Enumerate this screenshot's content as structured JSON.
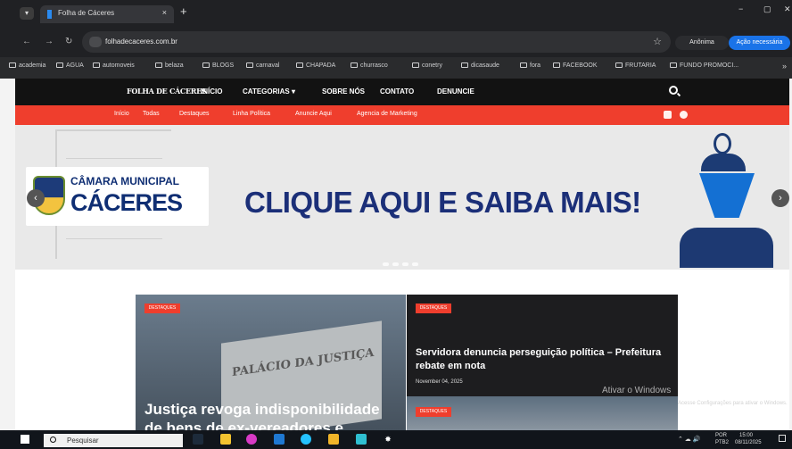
{
  "browser": {
    "tab_title": "Folha de Cáceres",
    "tab_close": "×",
    "new_tab": "+",
    "window_controls": [
      "−",
      "▢",
      "✕"
    ],
    "url": "folhadecaceres.com.br",
    "anonymous_label": "Anônima",
    "update_label": "Ação necessária",
    "nav_icons": [
      "←",
      "→",
      "↻"
    ],
    "bookmarks": [
      "academia",
      "AGUA",
      "automoveis",
      "belaza",
      "BLOGS",
      "carnaval",
      "CHAPADA",
      "churrasco",
      "conetry",
      "dicasaude",
      "fora",
      "FACEBOOK",
      "FRUTARIA",
      "FUNDO PROMOCI..."
    ]
  },
  "site": {
    "logo": "FOLHA DE CÁCERES",
    "nav": [
      "INÍCIO",
      "CATEGORIAS ▾",
      "SOBRE NÓS",
      "CONTATO",
      "DENUNCIE"
    ],
    "subnav": [
      "Início",
      "Todas",
      "Destaques",
      "Linha Política",
      "Anuncie Aqui",
      "Agencia de Marketing"
    ]
  },
  "banner": {
    "title_small": "CÂMARA MUNICIPAL",
    "title_big": "CÁCERES",
    "headline": "CLIQUE AQUI E SAIBA MAIS!",
    "left_arrow": "‹",
    "right_arrow": "›"
  },
  "posts": {
    "main_tag": "DESTAQUES",
    "main_title": "Justiça revoga indisponibilidade de bens de ex-vereadores e",
    "main_court_text": "PALÁCIO DA JUSTIÇA",
    "side_tag": "DESTAQUES",
    "side_title": "Servidora denuncia perseguição política – Prefeitura rebate em nota",
    "side_date": "November 04, 2025",
    "side2_tag": "DESTAQUES"
  },
  "watermark": {
    "main": "Ativar o Windows",
    "sub": "Acesse Configurações para ativar o Windows."
  },
  "taskbar": {
    "search_placeholder": "Pesquisar",
    "language": "POR",
    "language_sub": "PTB2",
    "time": "15:00",
    "date": "08/11/2025"
  }
}
